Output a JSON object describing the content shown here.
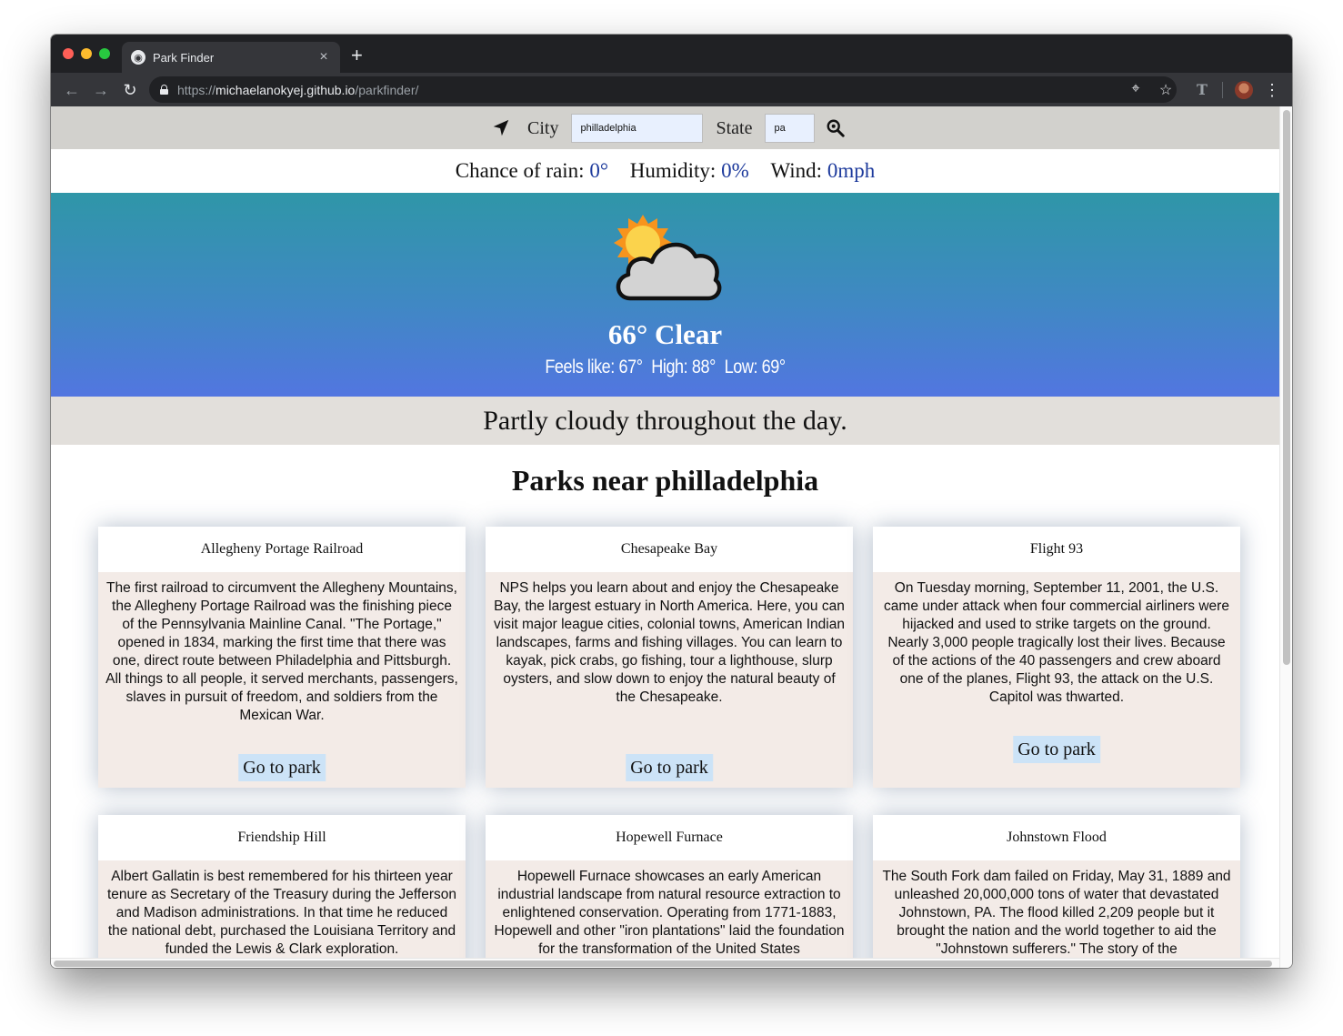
{
  "browser": {
    "tab_title": "Park Finder",
    "tab_close": "×",
    "new_tab": "+",
    "url_prefix": "https://",
    "url_host": "michaelanokyej.github.io",
    "url_path": "/parkfinder/",
    "icons": [
      "back-arrow-icon",
      "forward-arrow-icon",
      "reload-icon",
      "lock-icon",
      "location-target-icon",
      "star-icon",
      "extension-icon",
      "avatar",
      "kebab-menu-icon"
    ]
  },
  "search": {
    "city_label": "City",
    "city_value": "philladelphia",
    "state_label": "State",
    "state_value": "pa"
  },
  "stats": {
    "rain_label": "Chance of rain:",
    "rain_value": "0°",
    "humidity_label": "Humidity:",
    "humidity_value": "0%",
    "wind_label": "Wind:",
    "wind_value": "0mph",
    "value_color": "#1d3a9c"
  },
  "weather": {
    "icon": "partly-cloudy-icon",
    "temp_line": "66° Clear",
    "feels_like": "Feels like: 67°",
    "high": "High: 88°",
    "low": "Low: 69°",
    "summary": "Partly cloudy throughout the day."
  },
  "parks": {
    "heading": "Parks near philladelphia",
    "button_label": "Go to park",
    "items": [
      {
        "name": "Allegheny Portage Railroad",
        "description": "The first railroad to circumvent the Allegheny Mountains, the Allegheny Portage Railroad was the finishing piece of the Pennsylvania Mainline Canal. \"The Portage,\" opened in 1834, marking the first time that there was one, direct route between Philadelphia and Pittsburgh. All things to all people, it served merchants, passengers, slaves in pursuit of freedom, and soldiers from the Mexican War."
      },
      {
        "name": "Chesapeake Bay",
        "description": "NPS helps you learn about and enjoy the Chesapeake Bay, the largest estuary in North America. Here, you can visit major league cities, colonial towns, American Indian landscapes, farms and fishing villages. You can learn to kayak, pick crabs, go fishing, tour a lighthouse, slurp oysters, and slow down to enjoy the natural beauty of the Chesapeake."
      },
      {
        "name": "Flight 93",
        "description": "On Tuesday morning, September 11, 2001, the U.S. came under attack when four commercial airliners were hijacked and used to strike targets on the ground. Nearly 3,000 people tragically lost their lives. Because of the actions of the 40 passengers and crew aboard one of the planes, Flight 93, the attack on the U.S. Capitol was thwarted."
      },
      {
        "name": "Friendship Hill",
        "description": "Albert Gallatin is best remembered for his thirteen year tenure as Secretary of the Treasury during the Jefferson and Madison administrations. In that time he reduced the national debt, purchased the Louisiana Territory and funded the Lewis & Clark exploration."
      },
      {
        "name": "Hopewell Furnace",
        "description": "Hopewell Furnace showcases an early American industrial landscape from natural resource extraction to enlightened conservation. Operating from 1771-1883, Hopewell and other \"iron plantations\" laid the foundation for the transformation of the United States"
      },
      {
        "name": "Johnstown Flood",
        "description": "The South Fork dam failed on Friday, May 31, 1889 and unleashed 20,000,000 tons of water that devastated Johnstown, PA. The flood killed 2,209 people but it brought the nation and the world together to aid the \"Johnstown sufferers.\" The story of the"
      }
    ]
  }
}
